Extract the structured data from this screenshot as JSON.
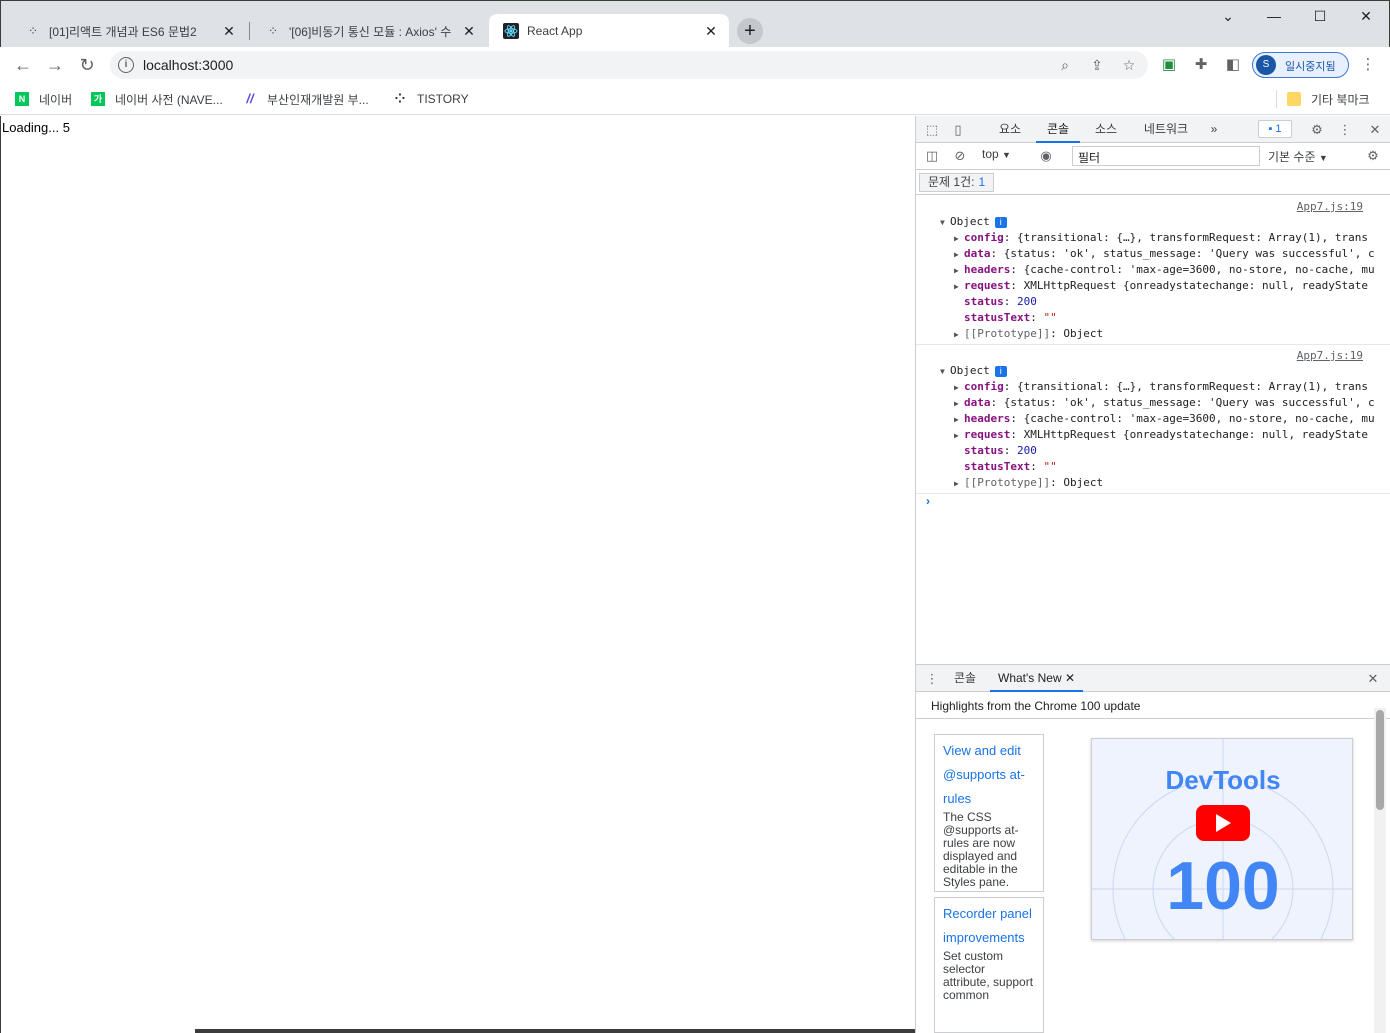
{
  "browser": {
    "tabs": [
      {
        "title": "[01]리액트 개념과 ES6 문법2",
        "active": false
      },
      {
        "title": "'[06]비동기 통신 모듈 : Axios' 수",
        "active": false
      },
      {
        "title": "React App",
        "active": true
      }
    ],
    "new_tab": "+",
    "window_controls": {
      "chevron": "⌄",
      "minimize": "—",
      "maximize": "☐",
      "close": "✕"
    },
    "url": "localhost:3000",
    "profile": {
      "initial": "S",
      "label": "일시중지됨"
    },
    "bookmarks": [
      {
        "label": "네이버",
        "icon_letter": "N",
        "color": "#03c75a"
      },
      {
        "label": "네이버 사전 (NAVE...",
        "icon_letter": "가",
        "color": "#03c75a"
      },
      {
        "label": "부산인재개발원 부...",
        "icon_letter": "//",
        "color": "#5b4ce0"
      },
      {
        "label": "TISTORY",
        "icon_letter": "⁘",
        "color": "#333333"
      }
    ],
    "other_bookmarks": "기타 북마크"
  },
  "page": {
    "loading_text": "Loading... 5"
  },
  "devtools": {
    "tabs": [
      "요소",
      "콘솔",
      "소스",
      "네트워크"
    ],
    "active_tab": "콘솔",
    "more": "»",
    "issue_badge": "1",
    "context": "top",
    "filter_value": "필터",
    "level": "기본 수준",
    "issues_label": "문제 1건:",
    "issues_count": "1",
    "logs": [
      {
        "source": "App7.js:19",
        "head": "Object",
        "rows": [
          {
            "key": "config",
            "value": "{transitional: {…}, transformRequest: Array(1), trans",
            "expandable": true
          },
          {
            "key": "data",
            "value": "{status: 'ok', status_message: 'Query was successful', c",
            "expandable": true
          },
          {
            "key": "headers",
            "value": "{cache-control: 'max-age=3600, no-store, no-cache, mu",
            "expandable": true
          },
          {
            "key": "request",
            "value": "XMLHttpRequest {onreadystatechange: null, readyState",
            "expandable": true
          },
          {
            "key": "status",
            "value": "200",
            "expandable": false
          },
          {
            "key": "statusText",
            "value": "\"\"",
            "expandable": false
          },
          {
            "key": "[[Prototype]]",
            "value": "Object",
            "expandable": true
          }
        ]
      },
      {
        "source": "App7.js:19",
        "head": "Object",
        "rows": [
          {
            "key": "config",
            "value": "{transitional: {…}, transformRequest: Array(1), trans",
            "expandable": true
          },
          {
            "key": "data",
            "value": "{status: 'ok', status_message: 'Query was successful', c",
            "expandable": true
          },
          {
            "key": "headers",
            "value": "{cache-control: 'max-age=3600, no-store, no-cache, mu",
            "expandable": true
          },
          {
            "key": "request",
            "value": "XMLHttpRequest {onreadystatechange: null, readyState",
            "expandable": true
          },
          {
            "key": "status",
            "value": "200",
            "expandable": false
          },
          {
            "key": "statusText",
            "value": "\"\"",
            "expandable": false
          },
          {
            "key": "[[Prototype]]",
            "value": "Object",
            "expandable": true
          }
        ]
      }
    ],
    "prompt": "›",
    "drawer": {
      "tabs": [
        "콘솔",
        "What's New"
      ],
      "active_tab": "What's New",
      "headline": "Highlights from the Chrome 100 update",
      "cards": [
        {
          "title": "View and edit @supports at-rules",
          "desc": "The CSS @supports at-rules are now displayed and editable in the Styles pane."
        },
        {
          "title": "Recorder panel improvements",
          "desc": "Set custom selector attribute, support common"
        }
      ],
      "thumbnail_title": "DevTools",
      "thumbnail_number": "100"
    }
  }
}
